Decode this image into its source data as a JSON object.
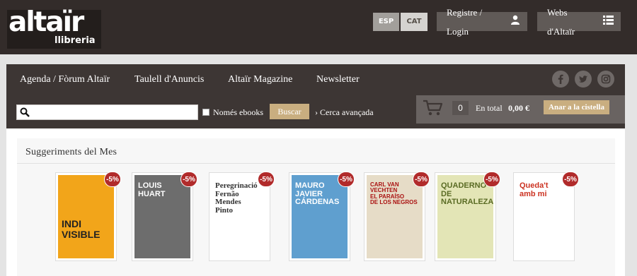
{
  "header": {
    "logo_main": "altaïr",
    "logo_sub": "llibreria",
    "lang_esp": "ESP",
    "lang_cat": "CAT",
    "login_label": "Registre / Login",
    "webs_label": "Webs d'Altaïr"
  },
  "nav": {
    "items": [
      "Agenda / Fòrum Altaïr",
      "Taulell d'Anuncis",
      "Altaïr Magazine",
      "Newsletter"
    ],
    "social": [
      "facebook-icon",
      "twitter-icon",
      "instagram-icon"
    ]
  },
  "search": {
    "placeholder": "",
    "value": "",
    "ebooks_label": "Només ebooks",
    "button_label": "Buscar",
    "advanced_label": "› Cerca avançada"
  },
  "cart": {
    "count": "0",
    "total_label": "En total",
    "total_value": "0,00 €",
    "button_label": "Anar a la cistella"
  },
  "suggestions": {
    "title": "Suggeriments del Mes",
    "books": [
      {
        "badge": "-5%",
        "cover_text": "INDI\nVISIBLE",
        "bg": "#f2a51a",
        "fg": "#222"
      },
      {
        "badge": "-5%",
        "cover_text": "LOUIS\nHUART",
        "bg": "#6d6d6d",
        "fg": "#fff"
      },
      {
        "badge": "-5%",
        "cover_text": "Peregrinació\nFernão\nMendes\nPinto",
        "bg": "#ffffff",
        "fg": "#333"
      },
      {
        "badge": "-5%",
        "cover_text": "MAURO JAVIER\nCÁRDENAS",
        "bg": "#5f9fcf",
        "fg": "#fff"
      },
      {
        "badge": "-5%",
        "cover_text": "CARL VAN VECHTEN\nEL PARAÍSO\nDE LOS NEGROS",
        "bg": "#e6dcc7",
        "fg": "#a11"
      },
      {
        "badge": "-5%",
        "cover_text": "QUADERNO\nDE\nNATURALEZA",
        "bg": "#e3e5b6",
        "fg": "#5a6b24"
      },
      {
        "badge": "-5%",
        "cover_text": "Queda't\namb mi",
        "bg": "#ffffff",
        "fg": "#c32"
      }
    ]
  }
}
